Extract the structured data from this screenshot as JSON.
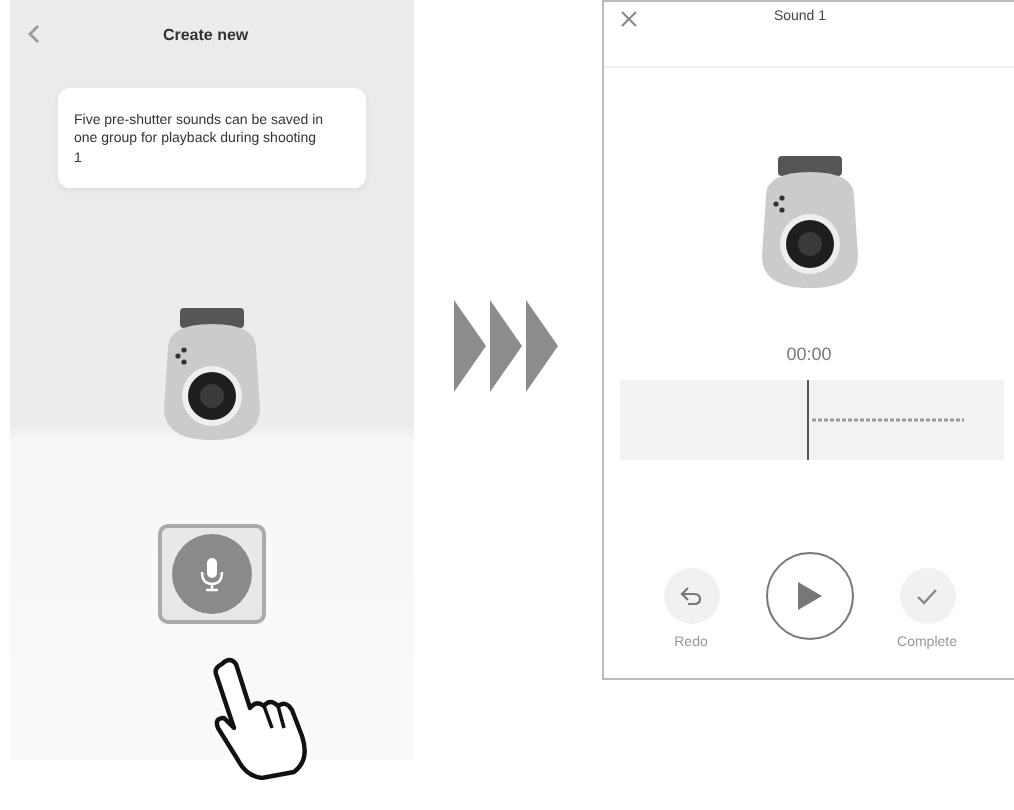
{
  "create_screen": {
    "title": "Create new",
    "tip": "Five pre-shutter sounds can be saved in one group for playback during shooting",
    "tip_mark": "1"
  },
  "sound_screen": {
    "title": "Sound 1",
    "time": "00:00",
    "buttons": [
      {
        "kind": "redo",
        "label": "Redo"
      },
      {
        "kind": "play"
      },
      {
        "kind": "complete",
        "label": "Complete"
      }
    ]
  }
}
